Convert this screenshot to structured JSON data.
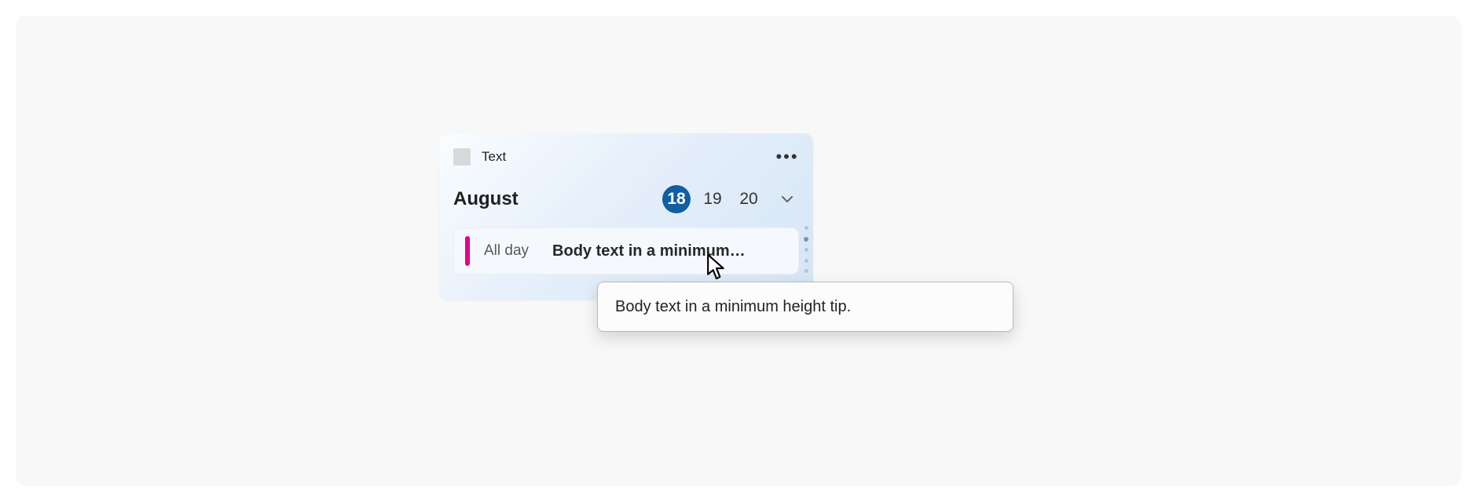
{
  "colors": {
    "accent": "#115ea3",
    "event_accent": "#e3008c"
  },
  "widget": {
    "title": "Text",
    "month": "August",
    "days": [
      "18",
      "19",
      "20"
    ],
    "selected_day_index": 0
  },
  "event": {
    "time_label": "All day",
    "title_truncated": "Body text in a minimum…"
  },
  "tooltip": {
    "text": "Body text in a minimum height tip."
  }
}
